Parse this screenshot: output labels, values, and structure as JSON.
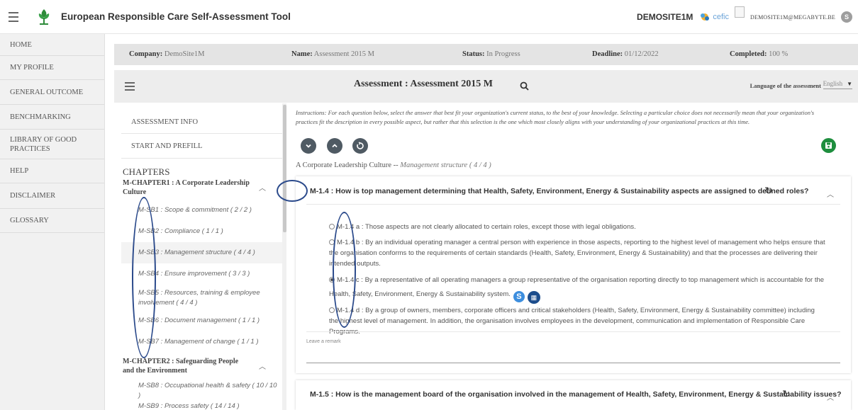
{
  "header": {
    "app_title": "European Responsible Care Self-Assessment Tool",
    "site_name": "DEMOSITE1M",
    "partner_logo_text": "cefic",
    "user_email": "DEMOSITE1M@MEGABYTE.BE",
    "user_initial": "S"
  },
  "left_nav": {
    "items": [
      {
        "label": "HOME"
      },
      {
        "label": "MY PROFILE"
      },
      {
        "label": "GENERAL OUTCOME"
      },
      {
        "label": "BENCHMARKING"
      },
      {
        "label": "LIBRARY OF GOOD PRACTICES"
      },
      {
        "label": "HELP"
      },
      {
        "label": "DISCLAIMER"
      },
      {
        "label": "GLOSSARY"
      }
    ]
  },
  "info_bar": {
    "company_label": "Company:",
    "company_value": "DemoSite1M",
    "name_label": "Name:",
    "name_value": "Assessment 2015 M",
    "status_label": "Status:",
    "status_value": "In Progress",
    "deadline_label": "Deadline:",
    "deadline_value": "01/12/2022",
    "completed_label": "Completed:",
    "completed_value": "100 %"
  },
  "assessment_header": {
    "title": "Assessment : Assessment 2015 M",
    "language_label": "Language of the assessment",
    "language_value": "English"
  },
  "chapters_panel": {
    "assessment_info": "ASSESSMENT INFO",
    "start_prefill": "START AND PREFILL",
    "chapters_title": "CHAPTERS",
    "chapter1": "M-CHAPTER1 : A Corporate Leadership Culture",
    "chapter1_items": [
      "M-SB1 : Scope & commitment ( 2 / 2 )",
      "M-SB2 : Compliance ( 1 / 1 )",
      "M-SB3 : Management structure ( 4 / 4 )",
      "M-SB4 : Ensure improvement ( 3 / 3 )",
      "M-SB5 : Resources, training & employee involvement ( 4 / 4 )",
      "M-SB6 : Document management ( 1 / 1 )",
      "M-SB7 : Management of change ( 1 / 1 )"
    ],
    "chapter2": "M-CHAPTER2 : Safeguarding People and the Environment",
    "chapter2_items": [
      "M-SB8 : Occupational health & safety ( 10 / 10 )",
      "M-SB9 : Process safety ( 14 / 14 )"
    ]
  },
  "main": {
    "instructions": "Instructions: For each question below, select the answer that best fit your organization's current status, to the best of your knowledge. Selecting a particular choice does not necessarily mean that your organization's practices fit the description in every possible aspect, but rather that this selection is the one which most closely aligns with your understanding of your organizational practices at this time.",
    "breadcrumb_section": "A Corporate Leadership Culture --",
    "breadcrumb_sub": "Management structure ( 4 / 4 )",
    "question1": {
      "title": "M-1.4 : How is top management determining that Health, Safety, Environment, Energy & Sustainability aspects are assigned to defined roles?",
      "options": [
        {
          "text": "M-1.4 a : Those aspects are not clearly allocated to certain roles, except those with legal obligations.",
          "selected": false
        },
        {
          "text": "M-1.4 b : By an individual operating manager a central person with experience in those aspects, reporting to the highest level of management who helps ensure that the organisation conforms to the requirements of certain standards (Health, Safety, Environment, Energy & Sustainability) and that the processes are delivering their intended outputs.",
          "selected": false
        },
        {
          "text": "M-1.4 c : By a representative of all operating managers a group representative of the organisation reporting directly to top management which is accountable for the Health, Safety, Environment, Energy & Sustainability system.",
          "selected": true
        },
        {
          "text": "M-1.4 d : By a group of owners, members, corporate officers and critical stakeholders (Health, Safety, Environment, Energy & Sustainability committee) including the highest level of management. In addition, the organisation involves employees in the development, communication and implementation of Responsible Care Programs.",
          "selected": false
        }
      ],
      "s_badge": "S",
      "remark_placeholder": "Leave a remark"
    },
    "question2": {
      "title": "M-1.5 : How is the management board of the organisation involved in the management of Health, Safety, Environment, Energy & Sustainability issues?"
    }
  },
  "colors": {
    "save_button": "#1e8e3e",
    "round_button": "#4f5a63",
    "annotation": "#2b4a8b",
    "s_badge": "#3d8ede",
    "b_badge": "#1c4d8c"
  }
}
